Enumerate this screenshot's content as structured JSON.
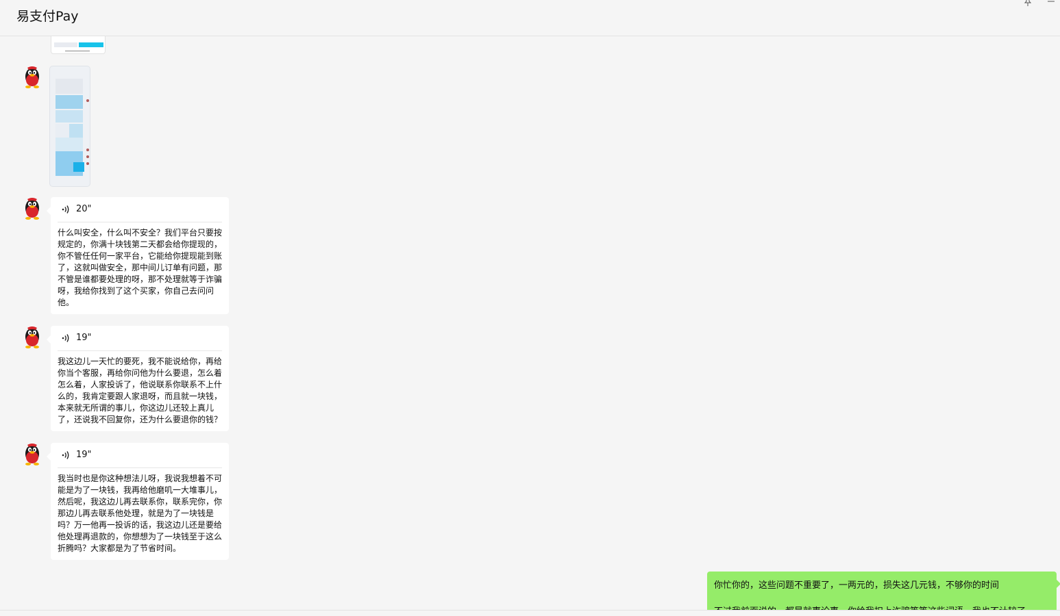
{
  "window": {
    "title": "易支付Pay",
    "pin_icon": "pin-icon",
    "minimize_icon": "minimize-icon"
  },
  "messages": [
    {
      "type": "image",
      "from": "contact",
      "avatar_icon": "qq-penguin-avatar-icon"
    },
    {
      "type": "image",
      "from": "contact",
      "avatar_icon": "qq-penguin-avatar-icon"
    },
    {
      "type": "voice",
      "from": "contact",
      "duration": "20\"",
      "transcript": "什么叫安全，什么叫不安全？我们平台只要按规定的，你满十块钱第二天都会给你提现的，你不管任任何一家平台，它能给你提现能到账了，这就叫做安全，那中间儿订单有问题，那不管是谁都要处理的呀，那不处理就等于诈骗呀，我给你找到了这个买家，你自己去问问他。"
    },
    {
      "type": "voice",
      "from": "contact",
      "duration": "19\"",
      "transcript": "我这边儿一天忙的要死，我不能说给你，再给你当个客服，再给你问他为什么要退，怎么着怎么着，人家投诉了，他说联系你联系不上什么的，我肯定要跟人家退呀，而且就一块钱，本来就无所谓的事儿，你这边儿还较上真儿了，还说我不回复你，还为什么要退你的钱？"
    },
    {
      "type": "voice",
      "from": "contact",
      "duration": "19\"",
      "transcript": "我当时也是你这种想法儿呀，我说我想着不可能是为了一块钱，我再给他磨叽一大堆事儿，然后呢，我这边儿再去联系你，联系完你，你那边儿再去联系他处理，就是为了一块钱是吗？万一他再一投诉的话，我这边儿还是要给他处理再退款的，你想想为了一块钱至于这么折腾吗？大家都是为了节省时间。"
    },
    {
      "type": "text",
      "from": "self",
      "line1": "你忙你的，这些问题不重要了，一两元的，损失这几元钱，不够你的时间",
      "line2": "不过我前面说的，都是就事论事，你给我扣上诈骗等等这些词语，我也不计较了"
    }
  ],
  "colors": {
    "self_bubble": "#95ec69",
    "contact_bubble": "#ffffff",
    "background": "#f5f5f5"
  }
}
